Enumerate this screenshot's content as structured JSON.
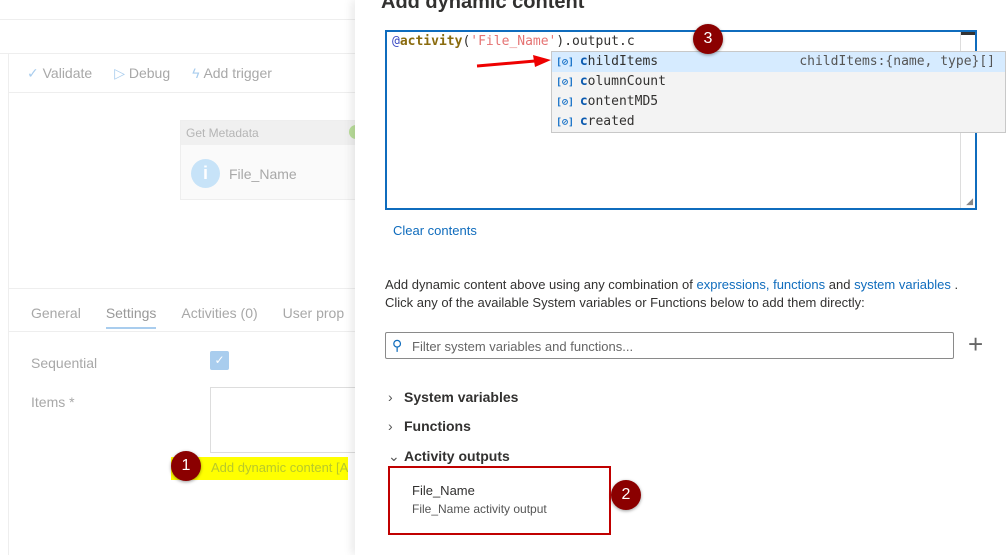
{
  "left": {
    "toolbar": {
      "validate": "Validate",
      "debug": "Debug",
      "add_trigger": "Add trigger"
    },
    "activity": {
      "type": "Get Metadata",
      "name": "File_Name"
    },
    "tabs": [
      "General",
      "Settings",
      "Activities (0)",
      "User prop"
    ],
    "active_tab": "Settings",
    "sequential_label": "Sequential",
    "sequential_checked": true,
    "items_label": "Items *",
    "add_dynamic_link": "Add dynamic content [Alt"
  },
  "panel": {
    "title": "Add dynamic content",
    "expr": {
      "at": "@",
      "fn": "activity",
      "open": "(",
      "str": "'File_Name'",
      "rest": ").output.c"
    },
    "suggestions": [
      {
        "match": "c",
        "rest": "hildItems",
        "detail": "childItems:{name, type}[]"
      },
      {
        "match": "c",
        "rest": "olumnCount"
      },
      {
        "match": "c",
        "rest": "ontentMD5"
      },
      {
        "match": "c",
        "rest": "reated"
      }
    ],
    "clear": "Clear contents",
    "help1": "Add dynamic content above using any combination of ",
    "link_expr": "expressions,",
    "link_func": "functions",
    "and": " and ",
    "link_sys": "system variables",
    "dot": " .",
    "help2": "Click any of the available System variables or Functions below to add them directly:",
    "filter_placeholder": "Filter system variables and functions...",
    "sections": [
      "System variables",
      "Functions",
      "Activity outputs"
    ],
    "output": {
      "name": "File_Name",
      "desc": "File_Name activity output"
    }
  },
  "badges": [
    "1",
    "2",
    "3"
  ]
}
